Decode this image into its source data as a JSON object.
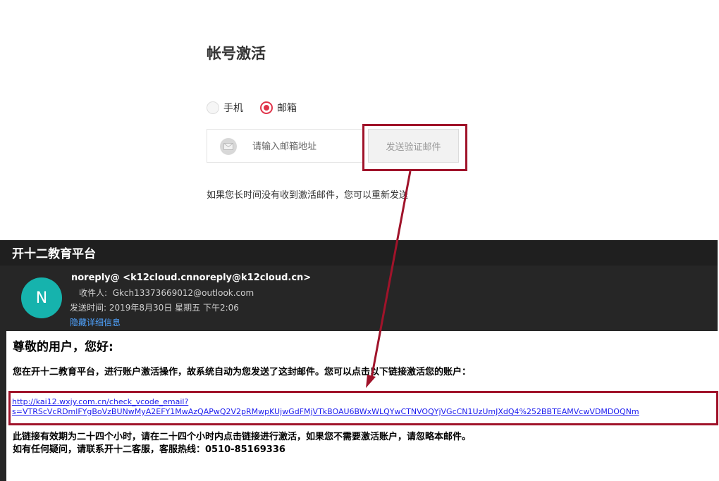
{
  "activation": {
    "title": "帐号激活",
    "options": [
      {
        "label": "手机",
        "selected": false
      },
      {
        "label": "邮箱",
        "selected": true
      }
    ],
    "email_placeholder": "请输入邮箱地址",
    "email_value": "",
    "send_button_label": "发送验证邮件",
    "resend_note": "如果您长时间没有收到激活邮件，您可以重新发送",
    "icon": "mail-icon"
  },
  "email": {
    "window_title": "开十二教育平台",
    "avatar_letter": "N",
    "avatar_color": "#16b3ad",
    "sender": "noreply@ <k12cloud.cnnoreply@k12cloud.cn>",
    "recipient_label": "收件人:",
    "recipient": "Gkch13373669012@outlook.com",
    "sent_time_label": "发送时间:",
    "sent_time": "2019年8月30日 星期五 下午2:06",
    "hide_details": "隐藏详细信息",
    "greeting": "尊敬的用户，您好:",
    "intro": "您在开十二教育平台，进行账户激活操作，故系统自动为您发送了这封邮件。您可以点击以下链接激活您的账户：",
    "link_line1": "http://kai12.wxjy.com.cn/check_vcode_email?",
    "link_line2": "s=VTRScVcRDmlFYgBoVzBUNwMyA2EFY1MwAzQAPwQ2V2pRMwpKUjwGdFMjVTkBOAU6BWxWLQYwCTNVOQYjVGcCN1UzUmJXdQ4%252BBTEAMVcwVDMDOQNm",
    "validity": "此链接有效期为二十四个小时，请在二十四个小时内点击链接进行激活，如果您不需要激活账户，请忽略本邮件。",
    "contact": "如有任何疑问，请联系开十二客服，客服热线：0510-85169336"
  },
  "colors": {
    "accent_red": "#e0344a",
    "highlight_border": "#a0132a",
    "link_blue": "#1a1aee",
    "dark_bg": "#262626"
  }
}
